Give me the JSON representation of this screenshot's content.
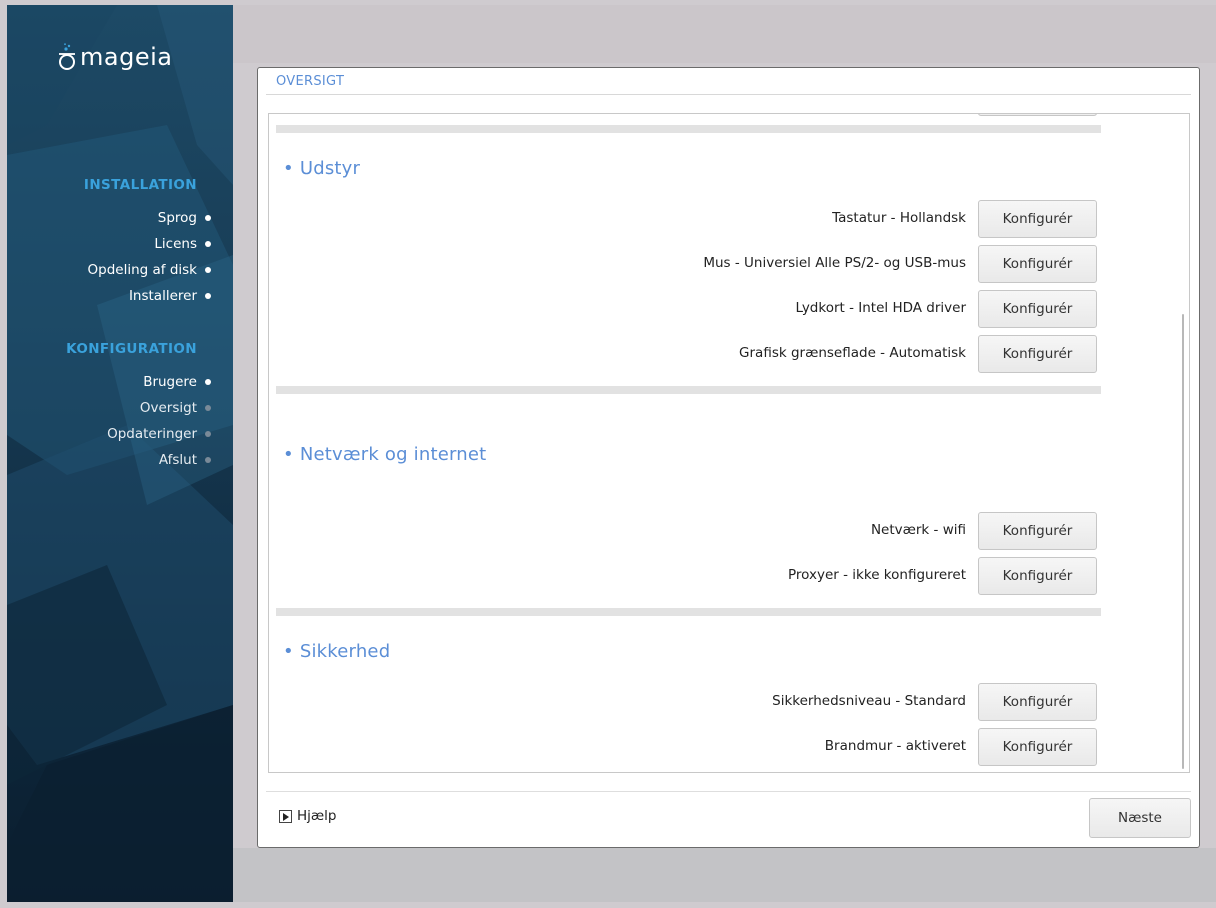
{
  "sidebar": {
    "logo_text": "mageia",
    "sections": [
      {
        "title": "INSTALLATION",
        "steps": [
          {
            "label": "Sprog",
            "state": "done"
          },
          {
            "label": "Licens",
            "state": "done"
          },
          {
            "label": "Opdeling af disk",
            "state": "done"
          },
          {
            "label": "Installerer",
            "state": "done"
          }
        ]
      },
      {
        "title": "KONFIGURATION",
        "steps": [
          {
            "label": "Brugere",
            "state": "done"
          },
          {
            "label": "Oversigt",
            "state": "current"
          },
          {
            "label": "Opdateringer",
            "state": "pending"
          },
          {
            "label": "Afslut",
            "state": "pending"
          }
        ]
      }
    ]
  },
  "page": {
    "title": "OVERSIGT"
  },
  "summary": {
    "categories": [
      {
        "name": "Udstyr",
        "items": [
          {
            "label": "Tastatur - Hollandsk",
            "button": "Konfigurér"
          },
          {
            "label": "Mus - Universiel Alle PS/2- og USB-mus",
            "button": "Konfigurér"
          },
          {
            "label": "Lydkort - Intel HDA driver",
            "button": "Konfigurér"
          },
          {
            "label": "Grafisk grænseflade - Automatisk",
            "button": "Konfigurér"
          }
        ]
      },
      {
        "name": "Netværk og internet",
        "items": [
          {
            "label": "Netværk - wifi",
            "button": "Konfigurér"
          },
          {
            "label": "Proxyer - ikke konfigureret",
            "button": "Konfigurér"
          }
        ]
      },
      {
        "name": "Sikkerhed",
        "items": [
          {
            "label": "Sikkerhedsniveau - Standard",
            "button": "Konfigurér"
          },
          {
            "label": "Brandmur - aktiveret",
            "button": "Konfigurér"
          }
        ]
      }
    ]
  },
  "footer": {
    "help_label": "Hjælp",
    "next_label": "Næste"
  },
  "colors": {
    "accent": "#5b8ed6",
    "section_title": "#3aa2dc",
    "sidebar_bg": "#183c55"
  }
}
